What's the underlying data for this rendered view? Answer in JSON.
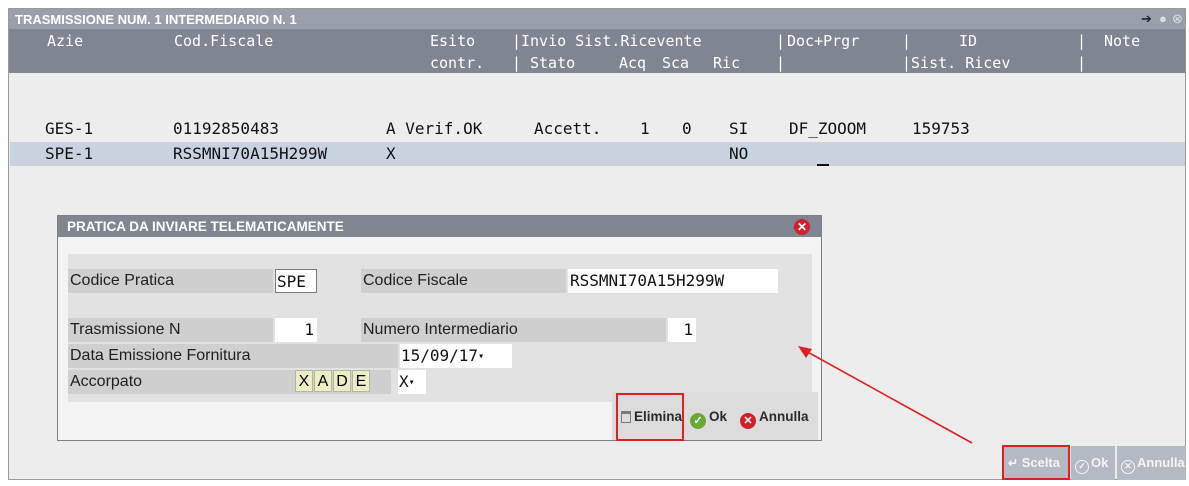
{
  "window": {
    "title": "TRASMISSIONE NUM.  1 INTERMEDIARIO N.  1",
    "pin_icon": "pin-icon",
    "close_icon": "close-icon"
  },
  "table": {
    "header_row1": [
      {
        "key": "azie",
        "text": "Azie"
      },
      {
        "key": "cod_fiscale",
        "text": "Cod.Fiscale"
      },
      {
        "key": "esito",
        "text": "Esito"
      },
      {
        "key": "sep1",
        "text": "|"
      },
      {
        "key": "invio",
        "text": "Invio Sist.Ricevente"
      },
      {
        "key": "sep2",
        "text": "|"
      },
      {
        "key": "doc",
        "text": "Doc+Prgr"
      },
      {
        "key": "sep3",
        "text": "|"
      },
      {
        "key": "id",
        "text": "ID"
      },
      {
        "key": "sep4",
        "text": "|"
      },
      {
        "key": "note",
        "text": "Note"
      }
    ],
    "header_row2": [
      {
        "key": "contr",
        "text": "contr."
      },
      {
        "key": "sep1",
        "text": "|"
      },
      {
        "key": "stato",
        "text": "Stato"
      },
      {
        "key": "acq",
        "text": "Acq"
      },
      {
        "key": "sca",
        "text": "Sca"
      },
      {
        "key": "ric",
        "text": "Ric"
      },
      {
        "key": "sep2",
        "text": "|"
      },
      {
        "key": "sist",
        "text": "|Sist. Ricev"
      },
      {
        "key": "sep3",
        "text": "|"
      }
    ],
    "rows": [
      {
        "azie": "GES-1",
        "cod_fiscale": "01192850483",
        "esito": "A Verif.OK",
        "stato": "Accett.",
        "acq": "1",
        "sca": "0",
        "ric": "SI",
        "doc": "DF_ZOOOM",
        "id": "159753"
      },
      {
        "azie": "SPE-1",
        "cod_fiscale": "RSSMNI70A15H299W",
        "esito": "X",
        "stato": "",
        "acq": "",
        "sca": "",
        "ric": "NO",
        "doc": "",
        "id": ""
      }
    ]
  },
  "dialog": {
    "title": "PRATICA DA INVIARE TELEMATICAMENTE",
    "close_icon": "close-icon",
    "codice_pratica_label": "Codice Pratica",
    "codice_pratica_value": "SPE",
    "codice_fiscale_label": "Codice Fiscale",
    "codice_fiscale_value": "RSSMNI70A15H299W",
    "trasmissione_label": "Trasmissione N",
    "trasmissione_value": "1",
    "numero_intermediario_label": "Numero Intermediario",
    "numero_intermediario_value": "1",
    "data_emissione_label": "Data Emissione Fornitura",
    "data_emissione_value": "15/09/17",
    "accorpato_label": "Accorpato",
    "accorpato_options": [
      "X",
      "A",
      "D",
      "E"
    ],
    "accorpato_value": "X",
    "buttons": {
      "elimina": "Elimina",
      "ok": "Ok",
      "annulla": "Annulla"
    }
  },
  "toolbar": {
    "scelta": "Scelta",
    "ok": "Ok",
    "annulla": "Annulla"
  },
  "colors": {
    "title_bar": "#9aa0ab",
    "header": "#7f8691",
    "selected_row": "#c9d3df",
    "highlight_red": "#e02020",
    "ok_green": "#6aa936",
    "cancel_red": "#d0202a"
  }
}
